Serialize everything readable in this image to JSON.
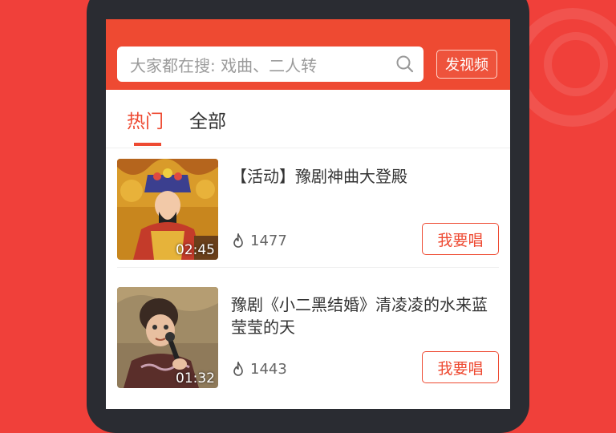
{
  "search": {
    "placeholder": "大家都在搜: 戏曲、二人转",
    "icon": "search-icon"
  },
  "header": {
    "post_video_label": "发视频"
  },
  "tabs": [
    {
      "label": "热门",
      "active": true
    },
    {
      "label": "全部",
      "active": false
    }
  ],
  "videos": [
    {
      "title": "【活动】豫剧神曲大登殿",
      "duration": "02:45",
      "views": "1477",
      "sing_label": "我要唱"
    },
    {
      "title": "豫剧《小二黑结婚》清凌凌的水来蓝莹莹的天",
      "duration": "01:32",
      "views": "1443",
      "sing_label": "我要唱"
    }
  ],
  "colors": {
    "accent": "#ee4a32",
    "background": "#f0403a",
    "phone_frame": "#2a2c32"
  }
}
